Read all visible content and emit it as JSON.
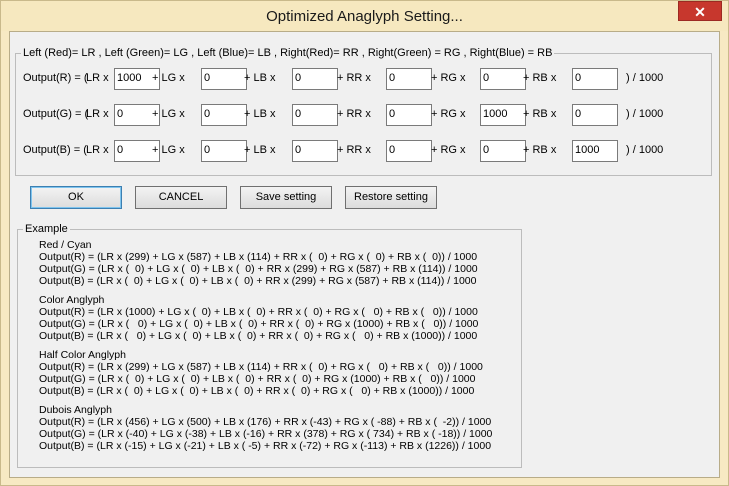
{
  "window": {
    "title": "Optimized Anaglyph Setting...",
    "close_label": "✕"
  },
  "definition": "Left (Red)= LR , Left (Green)= LG , Left (Blue)= LB , Right(Red)= RR , Right(Green) = RG , Right(Blue) = RB",
  "terms": [
    "LR x",
    "+ LG x",
    "+ LB x",
    "+ RR x",
    "+ RG x",
    "+ RB x"
  ],
  "suffix": ") / 1000",
  "rows": [
    {
      "label": "Output(R) = (",
      "values": [
        "1000",
        "0",
        "0",
        "0",
        "0",
        "0"
      ]
    },
    {
      "label": "Output(G) = (",
      "values": [
        "0",
        "0",
        "0",
        "0",
        "1000",
        "0"
      ]
    },
    {
      "label": "Output(B) = (",
      "values": [
        "0",
        "0",
        "0",
        "0",
        "0",
        "1000"
      ]
    }
  ],
  "buttons": {
    "ok": "OK",
    "cancel": "CANCEL",
    "save": "Save setting",
    "restore": "Restore setting"
  },
  "example": {
    "legend": "Example",
    "sections": [
      {
        "title": "Red / Cyan",
        "lines": [
          "Output(R) = (LR x (299) + LG x (587) + LB x (114) + RR x (  0) + RG x (  0) + RB x (  0)) / 1000",
          "Output(G) = (LR x (  0) + LG x (  0) + LB x (  0) + RR x (299) + RG x (587) + RB x (114)) / 1000",
          "Output(B) = (LR x (  0) + LG x (  0) + LB x (  0) + RR x (299) + RG x (587) + RB x (114)) / 1000"
        ]
      },
      {
        "title": "Color Anglyph",
        "lines": [
          "Output(R) = (LR x (1000) + LG x (  0) + LB x (  0) + RR x (  0) + RG x (   0) + RB x (   0)) / 1000",
          "Output(G) = (LR x (   0) + LG x (  0) + LB x (  0) + RR x (  0) + RG x (1000) + RB x (   0)) / 1000",
          "Output(B) = (LR x (   0) + LG x (  0) + LB x (  0) + RR x (  0) + RG x (   0) + RB x (1000)) / 1000"
        ]
      },
      {
        "title": "Half Color Anglyph",
        "lines": [
          "Output(R) = (LR x (299) + LG x (587) + LB x (114) + RR x (  0) + RG x (   0) + RB x (   0)) / 1000",
          "Output(G) = (LR x (  0) + LG x (  0) + LB x (  0) + RR x (  0) + RG x (1000) + RB x (   0)) / 1000",
          "Output(B) = (LR x (  0) + LG x (  0) + LB x (  0) + RR x (  0) + RG x (   0) + RB x (1000)) / 1000"
        ]
      },
      {
        "title": "Dubois Anglyph",
        "lines": [
          "Output(R) = (LR x (456) + LG x (500) + LB x (176) + RR x (-43) + RG x ( -88) + RB x (  -2)) / 1000",
          "Output(G) = (LR x (-40) + LG x (-38) + LB x (-16) + RR x (378) + RG x ( 734) + RB x ( -18)) / 1000",
          "Output(B) = (LR x (-15) + LG x (-21) + LB x ( -5) + RR x (-72) + RG x (-113) + RB x (1226)) / 1000"
        ]
      }
    ]
  }
}
